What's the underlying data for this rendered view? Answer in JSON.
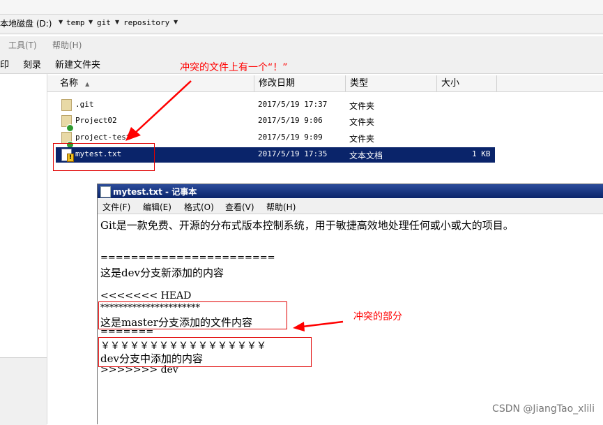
{
  "address": {
    "drive": "本地磁盘 (D:)",
    "segments": [
      "temp",
      "git",
      "repository"
    ],
    "arrow_icon": "dropdown-arrow"
  },
  "menu": {
    "tools": "工具(T)",
    "help": "帮助(H)"
  },
  "toolbar": {
    "print": "打印",
    "burn": "刻录",
    "new_folder": "新建文件夹"
  },
  "columns": {
    "name": "名称",
    "modified": "修改日期",
    "type": "类型",
    "size": "大小"
  },
  "files": [
    {
      "name": ".git",
      "date": "2017/5/19 17:37",
      "type": "文件夹",
      "size": "",
      "icon": "folder-icon"
    },
    {
      "name": "Project02",
      "date": "2017/5/19 9:06",
      "type": "文件夹",
      "size": "",
      "icon": "folder-ok-icon"
    },
    {
      "name": "project-test",
      "date": "2017/5/19 9:09",
      "type": "文件夹",
      "size": "",
      "icon": "folder-ok-icon"
    },
    {
      "name": "mytest.txt",
      "date": "2017/5/19 17:35",
      "type": "文本文档",
      "size": "1 KB",
      "icon": "file-conflict-icon",
      "selected": true
    }
  ],
  "notepad": {
    "title": "mytest.txt - 记事本",
    "menu": [
      "文件(F)",
      "编辑(E)",
      "格式(O)",
      "查看(V)",
      "帮助(H)"
    ],
    "lines": [
      "Git是一款免费、开源的分布式版本控制系统，用于敏捷高效地处理任何或小或大的项目。",
      "=======================",
      "这是dev分支新添加的内容",
      "<<<<<<< HEAD",
      "**********************",
      "这是master分支添加的文件内容",
      "=======",
      "￥￥￥￥￥￥￥￥￥￥￥￥￥￥￥￥￥",
      "dev分支中添加的内容",
      ">>>>>>> dev"
    ]
  },
  "annotations": {
    "file_note": "冲突的文件上有一个“！”",
    "conflict_note": "冲突的部分",
    "color": "#ff0000"
  },
  "watermark": "CSDN @JiangTao_xlili"
}
